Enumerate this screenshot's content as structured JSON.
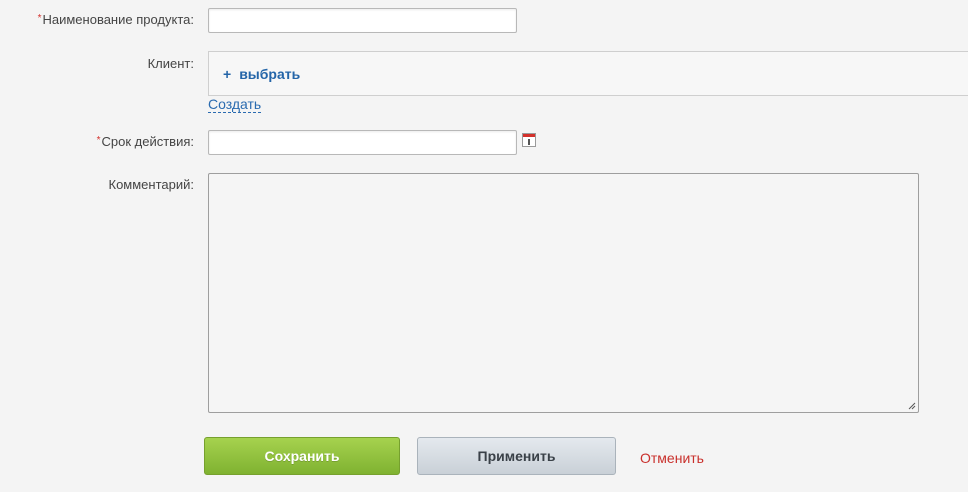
{
  "form": {
    "product_name": {
      "required_marker": "*",
      "label": "Наименование продукта:",
      "value": ""
    },
    "client": {
      "label": "Клиент:",
      "select_plus": "+",
      "select_label": "выбрать",
      "create_label": "Создать"
    },
    "expiry": {
      "required_marker": "*",
      "label": "Срок действия:",
      "value": ""
    },
    "comment": {
      "label": "Комментарий:",
      "value": ""
    }
  },
  "actions": {
    "save_label": "Сохранить",
    "apply_label": "Применить",
    "cancel_label": "Отменить"
  },
  "icons": {
    "calendar": "calendar-icon",
    "resize": "resize-grip-icon"
  },
  "colors": {
    "required": "#d3302b",
    "link": "#2465a8",
    "save_button": "#8bbd3a",
    "cancel_link": "#c9302c"
  }
}
